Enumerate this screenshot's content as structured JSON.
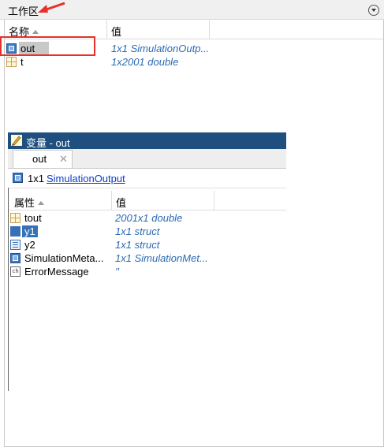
{
  "workspace": {
    "title": "工作区",
    "columns": {
      "name": "名称",
      "value": "值"
    },
    "rows": [
      {
        "icon": "simulation-output-icon",
        "name": "out",
        "value": "1x1 SimulationOutp..."
      },
      {
        "icon": "double-array-icon",
        "name": "t",
        "value": "1x2001 double"
      }
    ]
  },
  "variables": {
    "title": "变量 - out",
    "tab": {
      "label": "out",
      "close": "✕"
    },
    "summary": {
      "size": "1x1",
      "class_link": "SimulationOutput"
    },
    "columns": {
      "name": "属性",
      "value": "值"
    },
    "rows": [
      {
        "icon": "double-array-icon",
        "name": "tout",
        "value": "2001x1 double"
      },
      {
        "icon": "struct-icon",
        "name": "y1",
        "value": "1x1 struct"
      },
      {
        "icon": "struct-icon",
        "name": "y2",
        "value": "1x1 struct"
      },
      {
        "icon": "simulation-metadata-icon",
        "name": "SimulationMeta...",
        "value": "1x1 SimulationMet..."
      },
      {
        "icon": "char-icon",
        "name": "ErrorMessage",
        "value": "''"
      }
    ]
  },
  "colors": {
    "titlebar": "#1e4f7f",
    "value_text": "#2a6ab3",
    "highlight_red": "#e5312b",
    "link": "#0b3cc9",
    "selection": "#3572b8"
  }
}
